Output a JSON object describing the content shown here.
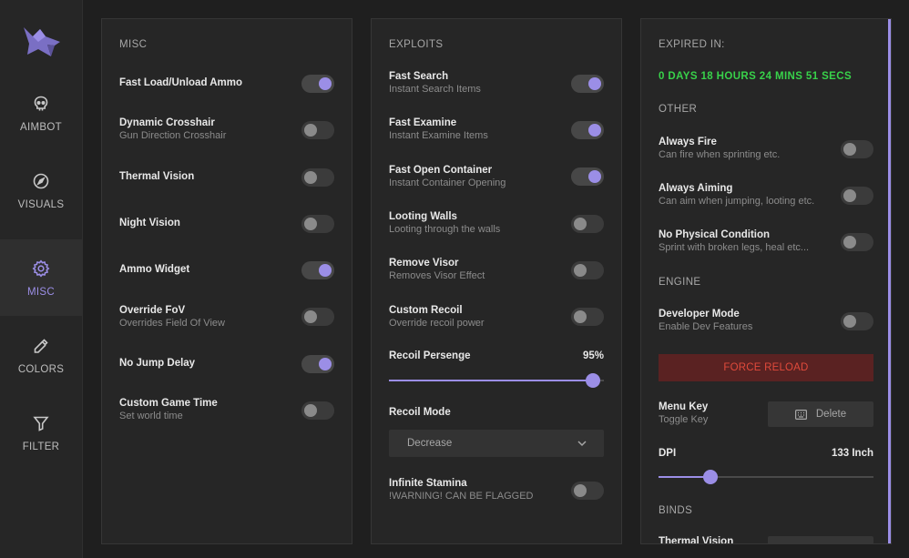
{
  "sidebar": {
    "items": [
      {
        "label": "AIMBOT",
        "icon": "skull-icon"
      },
      {
        "label": "VISUALS",
        "icon": "compass-icon"
      },
      {
        "label": "MISC",
        "icon": "gear-icon",
        "active": true
      },
      {
        "label": "COLORS",
        "icon": "eyedropper-icon"
      },
      {
        "label": "FILTER",
        "icon": "filter-icon"
      }
    ]
  },
  "misc": {
    "title": "MISC",
    "items": [
      {
        "label": "Fast Load/Unload Ammo",
        "sub": "",
        "on": true
      },
      {
        "label": "Dynamic Crosshair",
        "sub": "Gun Direction Crosshair",
        "on": false
      },
      {
        "label": "Thermal Vision",
        "sub": "",
        "on": false
      },
      {
        "label": "Night Vision",
        "sub": "",
        "on": false
      },
      {
        "label": "Ammo Widget",
        "sub": "",
        "on": true
      },
      {
        "label": "Override FoV",
        "sub": "Overrides Field Of View",
        "on": false
      },
      {
        "label": "No Jump Delay",
        "sub": "",
        "on": true
      },
      {
        "label": "Custom Game Time",
        "sub": "Set world time",
        "on": false
      }
    ]
  },
  "exploits": {
    "title": "EXPLOITS",
    "items": [
      {
        "label": "Fast Search",
        "sub": "Instant Search Items",
        "on": true
      },
      {
        "label": "Fast Examine",
        "sub": "Instant Examine Items",
        "on": true
      },
      {
        "label": "Fast Open Container",
        "sub": "Instant Container Opening",
        "on": true
      },
      {
        "label": "Looting Walls",
        "sub": "Looting through the walls",
        "on": false
      },
      {
        "label": "Remove Visor",
        "sub": "Removes Visor Effect",
        "on": false
      },
      {
        "label": "Custom Recoil",
        "sub": "Override recoil power",
        "on": false
      }
    ],
    "recoil_label": "Recoil Persenge",
    "recoil_value_text": "95%",
    "recoil_value": 0.95,
    "recoil_mode_label": "Recoil Mode",
    "recoil_mode_value": "Decrease",
    "stamina_label": "Infinite Stamina",
    "stamina_sub": "!WARNING! CAN BE FLAGGED",
    "stamina_on": false
  },
  "right": {
    "expired_title": "EXPIRED IN:",
    "expired_value": "0 DAYS 18 HOURS 24 MINS 51 SECS",
    "other_title": "OTHER",
    "other_items": [
      {
        "label": "Always Fire",
        "sub": "Can fire when sprinting etc.",
        "on": false
      },
      {
        "label": "Always Aiming",
        "sub": "Can aim when jumping, looting etc.",
        "on": false
      },
      {
        "label": "No Physical Condition",
        "sub": "Sprint with broken legs, heal etc...",
        "on": false
      }
    ],
    "engine_title": "ENGINE",
    "dev_label": "Developer Mode",
    "dev_sub": "Enable Dev Features",
    "dev_on": false,
    "force_reload": "FORCE RELOAD",
    "menu_key_label": "Menu Key",
    "menu_key_sub": "Toggle Key",
    "menu_key_value": "Delete",
    "dpi_label": "DPI",
    "dpi_value_text": "133 Inch",
    "dpi_value": 0.24,
    "binds_title": "BINDS",
    "binds_first": "Thermal Vision"
  },
  "colors": {
    "accent": "#9b8ee6",
    "green": "#38d24a",
    "danger": "#e04a3b"
  }
}
